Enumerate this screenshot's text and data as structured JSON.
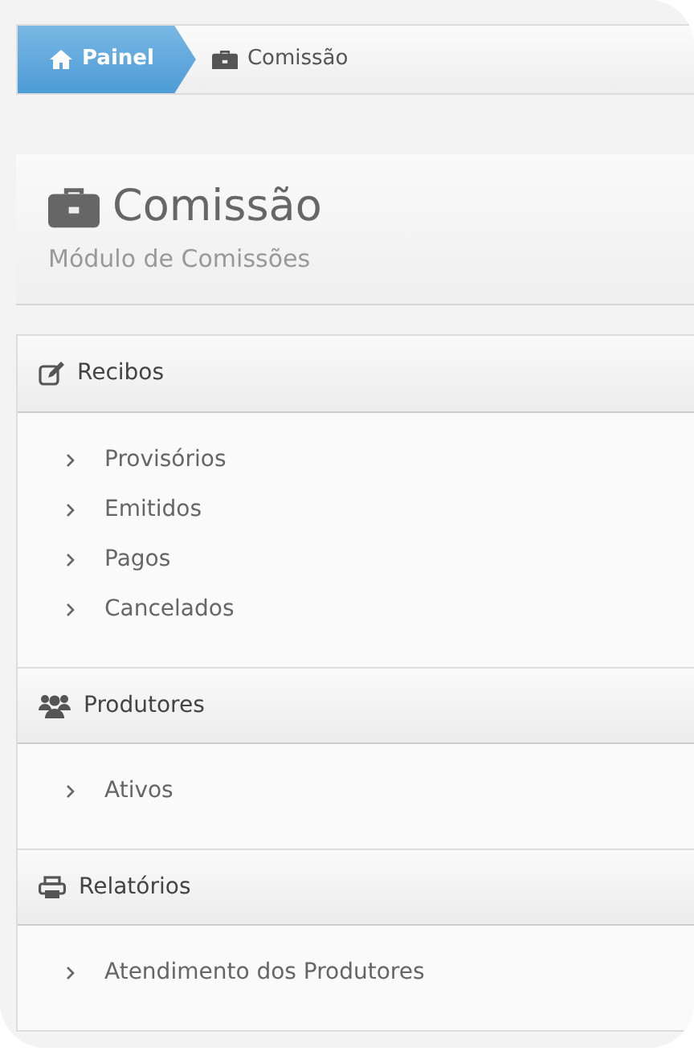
{
  "breadcrumb": [
    {
      "label": "Painel",
      "selected": true
    },
    {
      "label": "Comissão",
      "selected": false
    }
  ],
  "header": {
    "title": "Comissão",
    "subtitle": "Módulo de Comissões"
  },
  "sections": [
    {
      "kind": "edit",
      "title": "Recibos",
      "items": [
        "Provisórios",
        "Emitidos",
        "Pagos",
        "Cancelados"
      ]
    },
    {
      "kind": "users",
      "title": "Produtores",
      "items": [
        "Ativos"
      ]
    },
    {
      "kind": "print",
      "title": "Relatórios",
      "items": [
        "Atendimento dos Produtores"
      ]
    }
  ]
}
